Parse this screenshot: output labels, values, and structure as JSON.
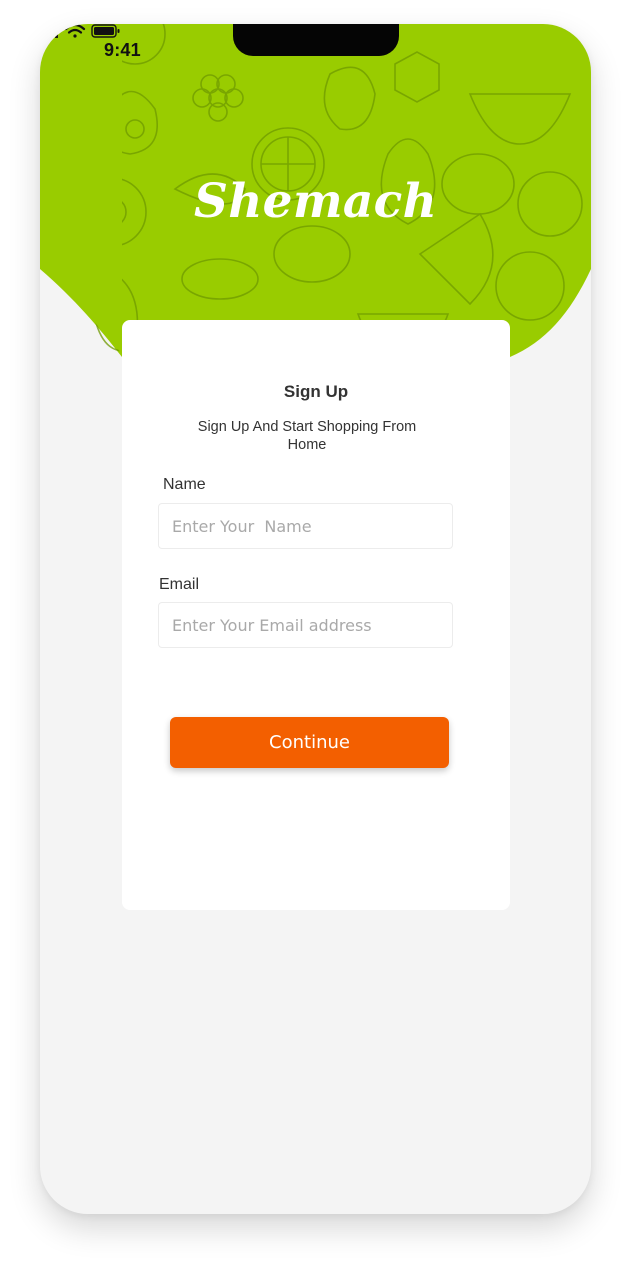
{
  "status_bar": {
    "time": "9:41"
  },
  "brand": {
    "name": "Shemach"
  },
  "form": {
    "title": "Sign Up",
    "subtitle": "Sign Up And Start Shopping From Home",
    "name_label": "Name",
    "name_placeholder": "Enter Your  Name",
    "email_label": "Email",
    "email_placeholder": "Enter Your Email address",
    "continue_label": "Continue"
  },
  "colors": {
    "header_green": "#99cc00",
    "accent_orange": "#f35f00",
    "background": "#f4f4f4"
  },
  "icons": [
    "cellular-signal-icon",
    "wifi-icon",
    "battery-icon",
    "fruit-pattern-background"
  ]
}
